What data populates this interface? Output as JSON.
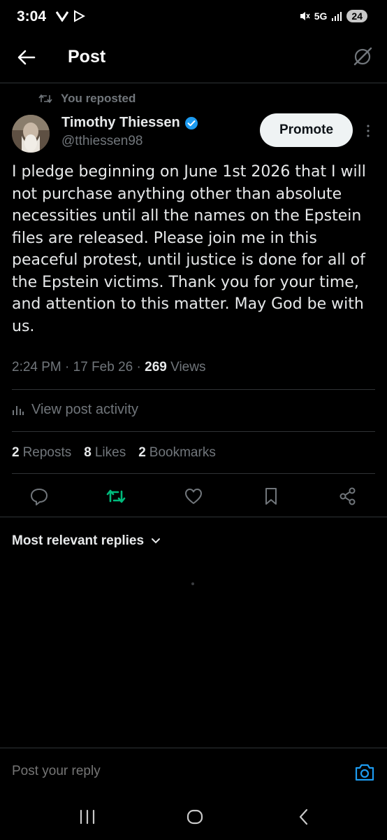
{
  "status": {
    "time": "3:04",
    "network": "5G",
    "battery": "24"
  },
  "header": {
    "title": "Post"
  },
  "repost_note": "You reposted",
  "author": {
    "name": "Timothy Thiessen",
    "handle": "@tthiessen98"
  },
  "promote_label": "Promote",
  "post": {
    "text": "I pledge beginning on June 1st 2026 that I will not purchase anything other than absolute necessities until all the names on the Epstein files are released. Please join me in this peaceful protest, until justice is done for all of the Epstein victims. Thank you for your time, and attention to this matter. May God be with us.",
    "time": "2:24 PM",
    "date": "17 Feb 26",
    "views_count": "269",
    "views_label": "Views"
  },
  "activity_label": "View post activity",
  "stats": [
    {
      "count": "2",
      "label": "Reposts"
    },
    {
      "count": "8",
      "label": "Likes"
    },
    {
      "count": "2",
      "label": "Bookmarks"
    }
  ],
  "replies_sort": "Most relevant replies",
  "reply": {
    "placeholder": "Post your reply"
  },
  "colors": {
    "accent": "#1d9bf0",
    "repost_active": "#00ba7c",
    "muted": "#71767b"
  },
  "icons": [
    "back-arrow-icon",
    "grok-icon",
    "repost-icon",
    "verified-icon",
    "more-icon",
    "activity-icon",
    "reply-icon",
    "like-icon",
    "bookmark-icon",
    "share-icon",
    "chevron-down-icon",
    "camera-icon"
  ]
}
